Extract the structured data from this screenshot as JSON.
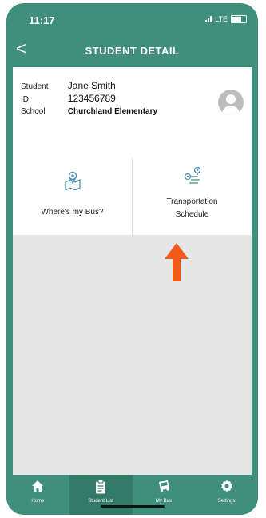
{
  "status_bar": {
    "time": "11:17",
    "network": "LTE"
  },
  "header": {
    "back_symbol": "<",
    "title": "STUDENT DETAIL"
  },
  "student": {
    "fields": [
      {
        "label": "Student",
        "value": "Jane Smith"
      },
      {
        "label": "ID",
        "value": "123456789"
      },
      {
        "label": "School",
        "value": "Churchland Elementary"
      }
    ],
    "avatar_icon": "user-avatar-icon"
  },
  "tiles": [
    {
      "label": "Where's my Bus?",
      "icon": "map-pin-icon"
    },
    {
      "label_line1": "Transportation",
      "label_line2": "Schedule",
      "icon": "route-icon"
    }
  ],
  "annotation": {
    "type": "arrow-up",
    "color": "#f05a1a"
  },
  "tabbar": [
    {
      "label": "Home",
      "icon": "home-icon"
    },
    {
      "label": "Student List",
      "icon": "clipboard-icon",
      "active": true
    },
    {
      "label": "My Bus",
      "icon": "bus-icon"
    },
    {
      "label": "Settings",
      "icon": "gear-icon"
    }
  ],
  "colors": {
    "brand": "#3f8f7c",
    "active_tab": "#347a69",
    "background": "#e6e6e6",
    "arrow": "#f05a1a"
  }
}
